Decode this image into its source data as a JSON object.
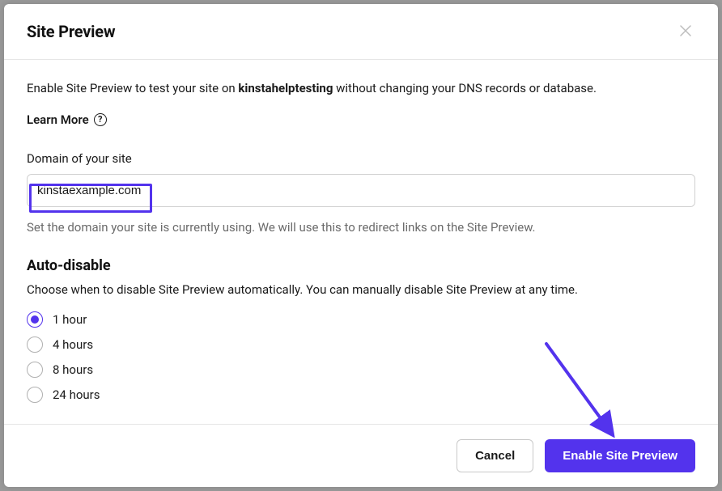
{
  "modal": {
    "title": "Site Preview",
    "intro_prefix": "Enable Site Preview to test your site on ",
    "intro_bold": "kinstahelptesting",
    "intro_suffix": " without changing your DNS records or database.",
    "learn_more": "Learn More",
    "domain_label": "Domain of your site",
    "domain_value": "kinstaexample.com",
    "domain_helper": "Set the domain your site is currently using. We will use this to redirect links on the Site Preview.",
    "auto_disable_title": "Auto-disable",
    "auto_disable_desc": "Choose when to disable Site Preview automatically. You can manually disable Site Preview at any time.",
    "radio_options": [
      {
        "label": "1 hour",
        "selected": true
      },
      {
        "label": "4 hours",
        "selected": false
      },
      {
        "label": "8 hours",
        "selected": false
      },
      {
        "label": "24 hours",
        "selected": false
      }
    ],
    "cancel_label": "Cancel",
    "submit_label": "Enable Site Preview"
  },
  "colors": {
    "accent": "#5333ed"
  }
}
